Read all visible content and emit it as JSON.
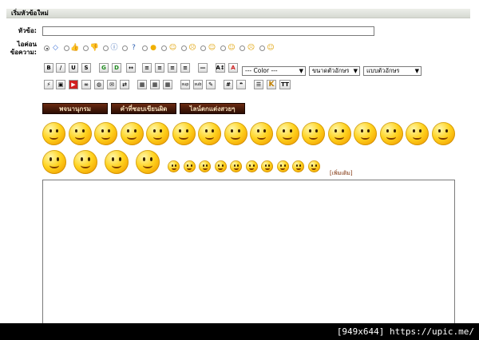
{
  "form": {
    "header": "เริ่มหัวข้อใหม่",
    "subject_label": "หัวข้อ:",
    "subject_value": "",
    "icon_label_line1": "ไอค่อน",
    "icon_label_line2": "ข้อความ:"
  },
  "post_icons": [
    {
      "name": "diamond-icon",
      "glyph": "◇",
      "color": "#3a6fd6",
      "selected": true
    },
    {
      "name": "thumbs-up-icon",
      "glyph": "👍",
      "color": "#c04020",
      "selected": false
    },
    {
      "name": "thumbs-down-icon",
      "glyph": "👎",
      "color": "#c04020",
      "selected": false
    },
    {
      "name": "exclamation-icon",
      "glyph": "ⓘ",
      "color": "#2a5db0",
      "selected": false
    },
    {
      "name": "question-icon",
      "glyph": "?",
      "color": "#2a5db0",
      "selected": false
    },
    {
      "name": "lightbulb-icon",
      "glyph": "●",
      "color": "#f0b000",
      "selected": false
    },
    {
      "name": "smile-icon",
      "glyph": "☺",
      "color": "#e0a000",
      "selected": false
    },
    {
      "name": "angry-icon",
      "glyph": "☹",
      "color": "#e0a000",
      "selected": false
    },
    {
      "name": "grin-icon",
      "glyph": "☺",
      "color": "#e0a000",
      "selected": false
    },
    {
      "name": "shocked-icon",
      "glyph": "☺",
      "color": "#e0a000",
      "selected": false
    },
    {
      "name": "sad-icon",
      "glyph": "☹",
      "color": "#e0a000",
      "selected": false
    },
    {
      "name": "wink-icon",
      "glyph": "☺",
      "color": "#e0a000",
      "selected": false
    }
  ],
  "toolbar": {
    "format_buttons": [
      {
        "name": "bold-button",
        "glyph": "B"
      },
      {
        "name": "italic-button",
        "glyph": "/"
      },
      {
        "name": "underline-button",
        "glyph": "U"
      },
      {
        "name": "strike-button",
        "glyph": "S"
      },
      {
        "name": "glow-button",
        "glyph": "G"
      },
      {
        "name": "shadow-button",
        "glyph": "D"
      },
      {
        "name": "move-button",
        "glyph": "↔"
      },
      {
        "name": "align-left-button",
        "glyph": "≡"
      },
      {
        "name": "align-center-button",
        "glyph": "≡"
      },
      {
        "name": "align-right-button",
        "glyph": "≡"
      },
      {
        "name": "justify-button",
        "glyph": "≡"
      },
      {
        "name": "horizontal-rule-button",
        "glyph": "—"
      },
      {
        "name": "font-size-button",
        "glyph": "A↕"
      },
      {
        "name": "font-color-button",
        "glyph": "A"
      }
    ],
    "color_select": "--- Color ---",
    "size_select": "ขนาดตัวอักษร",
    "font_select": "แบบตัวอักษร",
    "insert_buttons": [
      {
        "name": "flash-button",
        "glyph": "⚡"
      },
      {
        "name": "image-button",
        "glyph": "▣"
      },
      {
        "name": "youtube-button",
        "glyph": "▶"
      },
      {
        "name": "link-button",
        "glyph": "∞"
      },
      {
        "name": "globe-button",
        "glyph": "◍"
      },
      {
        "name": "email-button",
        "glyph": "✉"
      },
      {
        "name": "ftp-button",
        "glyph": "⇄"
      },
      {
        "name": "table-button",
        "glyph": "▦"
      },
      {
        "name": "table-row-button",
        "glyph": "▦"
      },
      {
        "name": "table-cell-button",
        "glyph": "▦"
      },
      {
        "name": "superscript-button",
        "glyph": "sup"
      },
      {
        "name": "subscript-button",
        "glyph": "sub"
      },
      {
        "name": "teletype-button",
        "glyph": "✎"
      },
      {
        "name": "code-button",
        "glyph": "#"
      },
      {
        "name": "quote-button",
        "glyph": "❝"
      },
      {
        "name": "list-button",
        "glyph": "☰"
      },
      {
        "name": "k-button",
        "glyph": "K"
      },
      {
        "name": "tt-button",
        "glyph": "TT"
      }
    ]
  },
  "tabs": [
    "พจนานุกรม",
    "คำที่ชอบเขียนผิด",
    "ไลน์ตกแต่งสวยๆ"
  ],
  "smileys_row1_count": 16,
  "smileys_row2_big_count": 4,
  "smileys_row2_small_count": 10,
  "more_link": "[เพิ่มเติม]",
  "watermark": "[949x644] https://upic.me/",
  "colors": {
    "tab_bg": "#3a1206",
    "tab_text": "#f3ddba",
    "link": "#7a2a00"
  }
}
